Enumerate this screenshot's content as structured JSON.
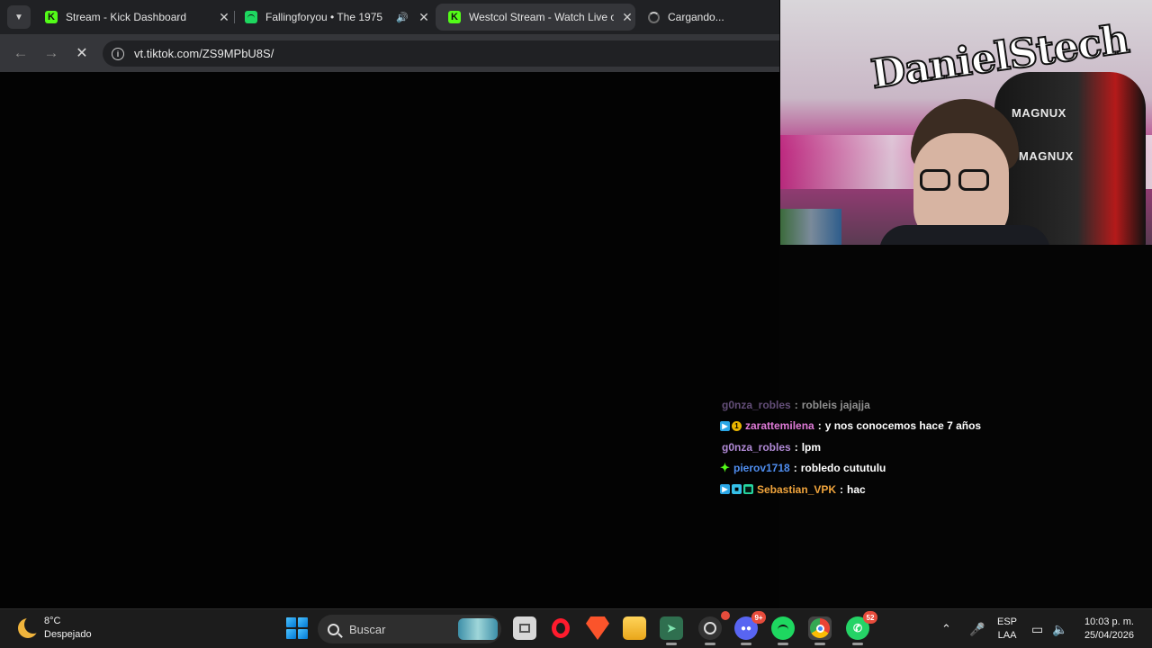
{
  "browser": {
    "tabs": [
      {
        "title": "Stream - Kick Dashboard",
        "favicon": "kick-icon"
      },
      {
        "title": "Fallingforyou • The 1975",
        "favicon": "spotify-icon"
      },
      {
        "title": "Westcol Stream - Watch Live on",
        "favicon": "kick-icon"
      },
      {
        "title": "Cargando...",
        "favicon": "loading-spinner-icon"
      }
    ],
    "active_tab": 2,
    "url": "vt.tiktok.com/ZS9MPbU8S/"
  },
  "webcam": {
    "graffiti_text": "DanielStech",
    "chair_brand": "MAGNUX"
  },
  "chat": {
    "messages": [
      {
        "user": "g0nza_robles",
        "text": "robleis jajajja",
        "color": "#b18ad6"
      },
      {
        "user": "zarattemilena",
        "text": "y nos conocemos hace 7 años",
        "color": "#e07bd8"
      },
      {
        "user": "g0nza_robles",
        "text": "lpm",
        "color": "#b18ad6"
      },
      {
        "user": "pierov1718",
        "text": "robledo cututulu",
        "color": "#4f8ef0"
      },
      {
        "user": "Sebastian_VPK",
        "text": "hac",
        "color": "#f0a43c"
      }
    ]
  },
  "taskbar": {
    "weather_temp": "8°C",
    "weather_desc": "Despejado",
    "search_placeholder": "Buscar",
    "whatsapp_badge": "52",
    "discord_badge": "9+",
    "lang_top": "ESP",
    "lang_bottom": "LAA",
    "time": "10:03 p. m.",
    "date": "25/04/2026"
  }
}
